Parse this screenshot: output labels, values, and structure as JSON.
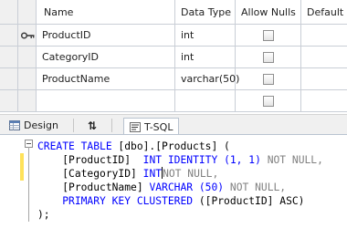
{
  "grid": {
    "headers": [
      "Name",
      "Data Type",
      "Allow Nulls",
      "Default"
    ],
    "rows": [
      {
        "name": "ProductID",
        "type": "int",
        "allow_nulls": false,
        "is_key": true
      },
      {
        "name": "CategoryID",
        "type": "int",
        "allow_nulls": false,
        "is_key": false
      },
      {
        "name": "ProductName",
        "type": "varchar(50)",
        "allow_nulls": false,
        "is_key": false
      },
      {
        "name": "",
        "type": "",
        "allow_nulls": false,
        "is_key": false
      }
    ]
  },
  "tabs": {
    "design": "Design",
    "swap": "⇅",
    "tsql": "T-SQL"
  },
  "sql": {
    "line1": {
      "kw": "CREATE TABLE",
      "rest": " [dbo].[Products] ("
    },
    "line2": {
      "col": "[ProductID]",
      "type": "INT IDENTITY (1, 1)",
      "null": "NOT NULL,"
    },
    "line3": {
      "col": "[CategoryID]",
      "type": "INT",
      "null": "NOT NULL,"
    },
    "line4": {
      "col": "[ProductName]",
      "type": "VARCHAR (50)",
      "null": "NOT NULL,"
    },
    "line5": {
      "kw": "PRIMARY KEY CLUSTERED",
      "rest": " ([ProductID] ASC)"
    },
    "line6": ");"
  },
  "colors": {
    "keyword": "#0000ff",
    "comment_gray": "#808080",
    "change_marker": "#ffe25a",
    "grid_line": "#c9ced6"
  },
  "icons": {
    "primary_key": "key-icon",
    "design_tab": "design-icon",
    "tsql_tab": "tsql-icon",
    "swap": "swap-icon"
  }
}
